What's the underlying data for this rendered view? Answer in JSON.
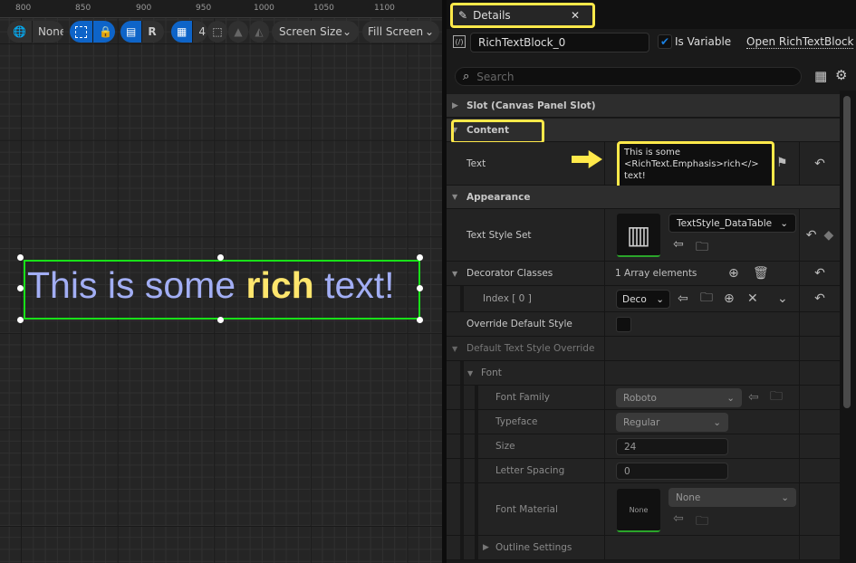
{
  "viewport": {
    "ruler_ticks": [
      "800",
      "850",
      "900",
      "950",
      "1000",
      "1050",
      "1100"
    ],
    "toolbar": {
      "localization_label": "None",
      "r_label": "R",
      "grid_snap_value": "4",
      "screen_size_label": "Screen Size",
      "fill_screen_label": "Fill Screen"
    },
    "preview": {
      "before": "This is some ",
      "bold": "rich",
      "after": " text!"
    },
    "colors": {
      "text": "#a2aef4",
      "emphasis": "#ffe66d",
      "selection": "#18e018"
    }
  },
  "details": {
    "tab_label": "Details",
    "widget_name": "RichTextBlock_0",
    "is_variable_label": "Is Variable",
    "is_variable_checked": true,
    "open_link": "Open RichTextBlock",
    "search_placeholder": "Search",
    "sections": {
      "slot": "Slot (Canvas Panel Slot)",
      "content": "Content",
      "appearance": "Appearance",
      "default_override": "Default Text Style Override",
      "font": "Font",
      "outline": "Outline Settings"
    },
    "props": {
      "text_label": "Text",
      "text_value_1": "This is some",
      "text_value_2": "<RichText.Emphasis>rich</>",
      "text_value_3": "text!",
      "text_style_set_label": "Text Style Set",
      "text_style_set_value": "TextStyle_DataTable",
      "decorator_classes_label": "Decorator Classes",
      "decorator_classes_value": "1 Array elements",
      "index0_label": "Index [ 0 ]",
      "index0_value": "Deco",
      "override_label": "Override Default Style",
      "font_family_label": "Font Family",
      "font_family_value": "Roboto",
      "typeface_label": "Typeface",
      "typeface_value": "Regular",
      "size_label": "Size",
      "size_value": "24",
      "letter_spacing_label": "Letter Spacing",
      "letter_spacing_value": "0",
      "font_material_label": "Font Material",
      "font_material_thumb": "None",
      "font_material_value": "None"
    },
    "highlight_color": "#ffe94a"
  }
}
